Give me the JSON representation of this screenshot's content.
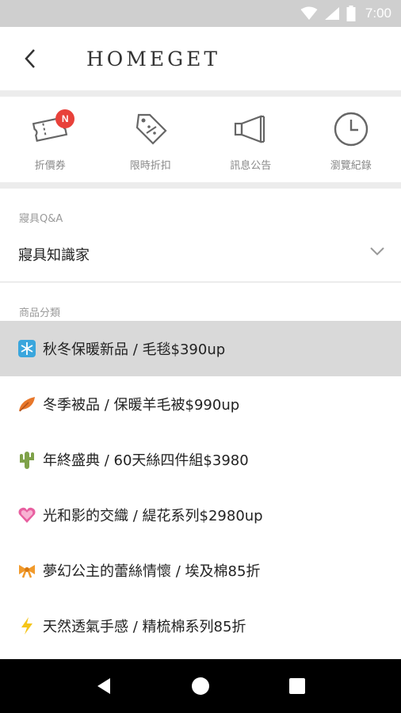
{
  "status_bar": {
    "time": "7:00"
  },
  "header": {
    "title": "HOMEGET"
  },
  "quick_actions": [
    {
      "label": "折價券",
      "icon": "coupon-icon",
      "badge": "N"
    },
    {
      "label": "限時折扣",
      "icon": "discount-tag-icon"
    },
    {
      "label": "訊息公告",
      "icon": "megaphone-icon"
    },
    {
      "label": "瀏覽紀錄",
      "icon": "clock-icon"
    }
  ],
  "qa_section": {
    "heading": "寢具Q&A",
    "row_label": "寢具知識家"
  },
  "category_section": {
    "heading": "商品分類"
  },
  "categories": [
    {
      "text": "秋冬保暖新品 / 毛毯$390up",
      "icon": "snowflake-icon",
      "color": "#3aa6dd",
      "active": true
    },
    {
      "text": "冬季被品  /  保暖羊毛被$990up",
      "icon": "leaf-icon",
      "color": "#e8772a"
    },
    {
      "text": "年終盛典 / 60天絲四件組$3980",
      "icon": "cactus-icon",
      "color": "#7fa24a"
    },
    {
      "text": "光和影的交織 / 緹花系列$2980up",
      "icon": "heart-icon",
      "color": "#e85fa0"
    },
    {
      "text": "夢幻公主的蕾絲情懷 / 埃及棉85折",
      "icon": "ribbon-icon",
      "color": "#f19a2b"
    },
    {
      "text": "天然透氣手感 / 精梳棉系列85折",
      "icon": "lightning-icon",
      "color": "#f5c518"
    }
  ],
  "colors": {
    "badge": "#e8413a",
    "active_row": "#d9d9d9",
    "status_bar": "#cfcfcf"
  }
}
